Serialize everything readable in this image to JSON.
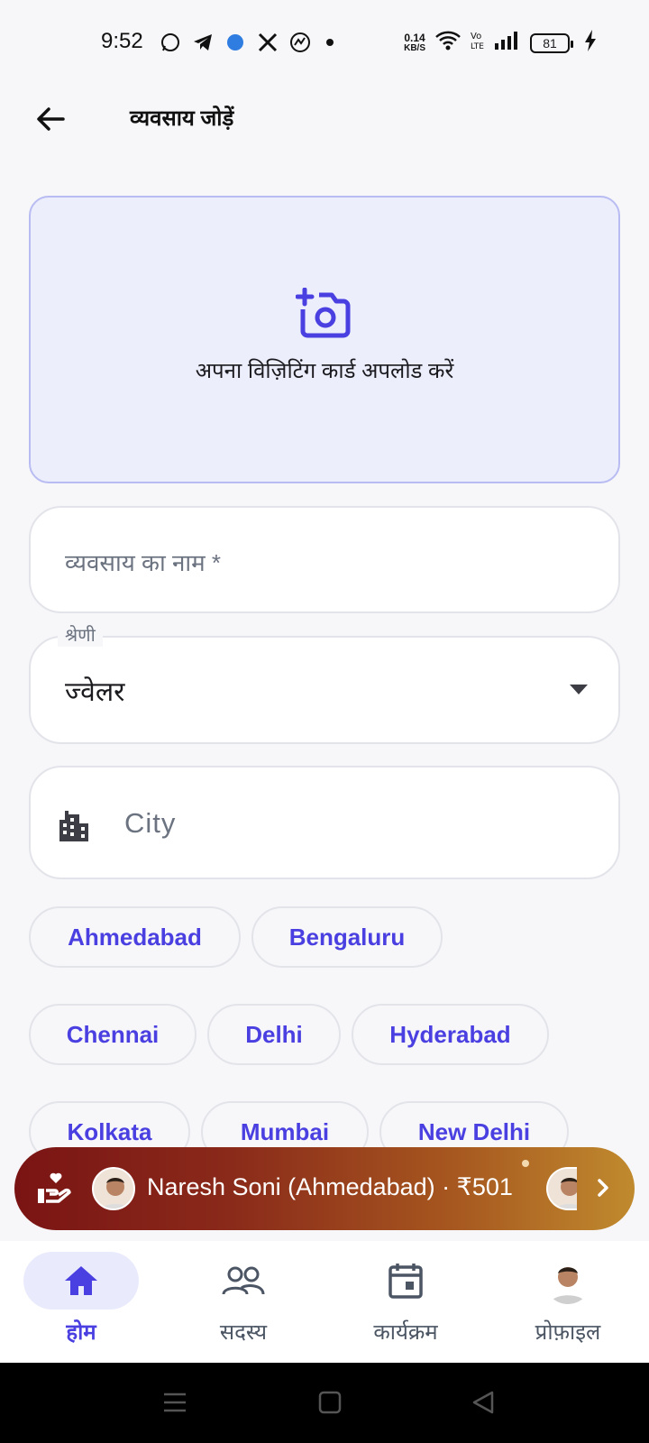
{
  "status_bar": {
    "time": "9:52",
    "speed_value": "0.14",
    "speed_unit": "KB/S",
    "battery": "81"
  },
  "app_bar": {
    "title": "व्यवसाय जोड़ें"
  },
  "upload": {
    "label": "अपना विज़िटिंग कार्ड अपलोड करें"
  },
  "form": {
    "business_name_placeholder": "व्यवसाय का नाम *",
    "category_label": "श्रेणी",
    "category_value": "ज्वेलर",
    "city_placeholder": "City"
  },
  "city_chips": [
    "Ahmedabad",
    "Bengaluru",
    "Chennai",
    "Delhi",
    "Hyderabad",
    "Kolkata",
    "Mumbai",
    "New Delhi"
  ],
  "banner": {
    "text": "Naresh Soni (Ahmedabad) · ₹501"
  },
  "bottom_nav": [
    {
      "label": "होम",
      "icon": "home-icon",
      "active": true
    },
    {
      "label": "सदस्य",
      "icon": "members-icon",
      "active": false
    },
    {
      "label": "कार्यक्रम",
      "icon": "calendar-icon",
      "active": false
    },
    {
      "label": "प्रोफ़ाइल",
      "icon": "profile-avatar",
      "active": false
    }
  ],
  "colors": {
    "accent": "#4a3fe0",
    "upload_bg": "#eceefc",
    "banner_start": "#7a1414",
    "banner_end": "#c08a2e"
  }
}
